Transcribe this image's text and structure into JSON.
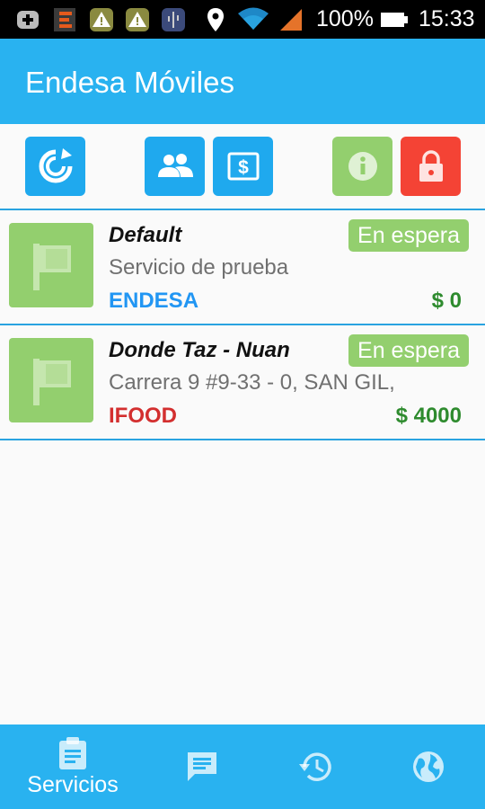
{
  "status_bar": {
    "battery_percent": "100%",
    "time": "15:33",
    "icons": [
      "plus-notification-icon",
      "app-notification-icon",
      "warning-icon",
      "warning-icon",
      "usb-icon",
      "location-icon",
      "wifi-icon",
      "signal-icon",
      "battery-icon"
    ]
  },
  "app_bar": {
    "title": "Endesa Móviles"
  },
  "toolbar": {
    "buttons": [
      {
        "icon": "refresh-icon",
        "color": "#1fa9ee"
      },
      {
        "icon": "people-icon",
        "color": "#1fa9ee"
      },
      {
        "icon": "money-icon",
        "color": "#1fa9ee"
      },
      {
        "icon": "info-icon",
        "color": "#93cf6e"
      },
      {
        "icon": "lock-icon",
        "color": "#f44335"
      }
    ]
  },
  "services": [
    {
      "name": "Default",
      "status": "En espera",
      "address": "Servicio de prueba",
      "client": "ENDESA",
      "price": "$ 0"
    },
    {
      "name": "Donde Taz - Nuan",
      "status": "En espera",
      "address": "Carrera 9 #9-33 - 0, SAN GIL,",
      "client": "IFOOD",
      "price": "$ 4000"
    }
  ],
  "bottom_nav": {
    "items": [
      {
        "label": "Servicios",
        "icon": "clipboard-icon",
        "selected": true
      },
      {
        "icon": "chat-icon"
      },
      {
        "icon": "history-icon"
      },
      {
        "icon": "globe-icon"
      }
    ]
  },
  "colors": {
    "primary": "#29b2f0",
    "accent_blue": "#1fa9ee",
    "status_green": "#93cf6e",
    "danger_red": "#f44335",
    "price_green": "#2e8b2e"
  }
}
